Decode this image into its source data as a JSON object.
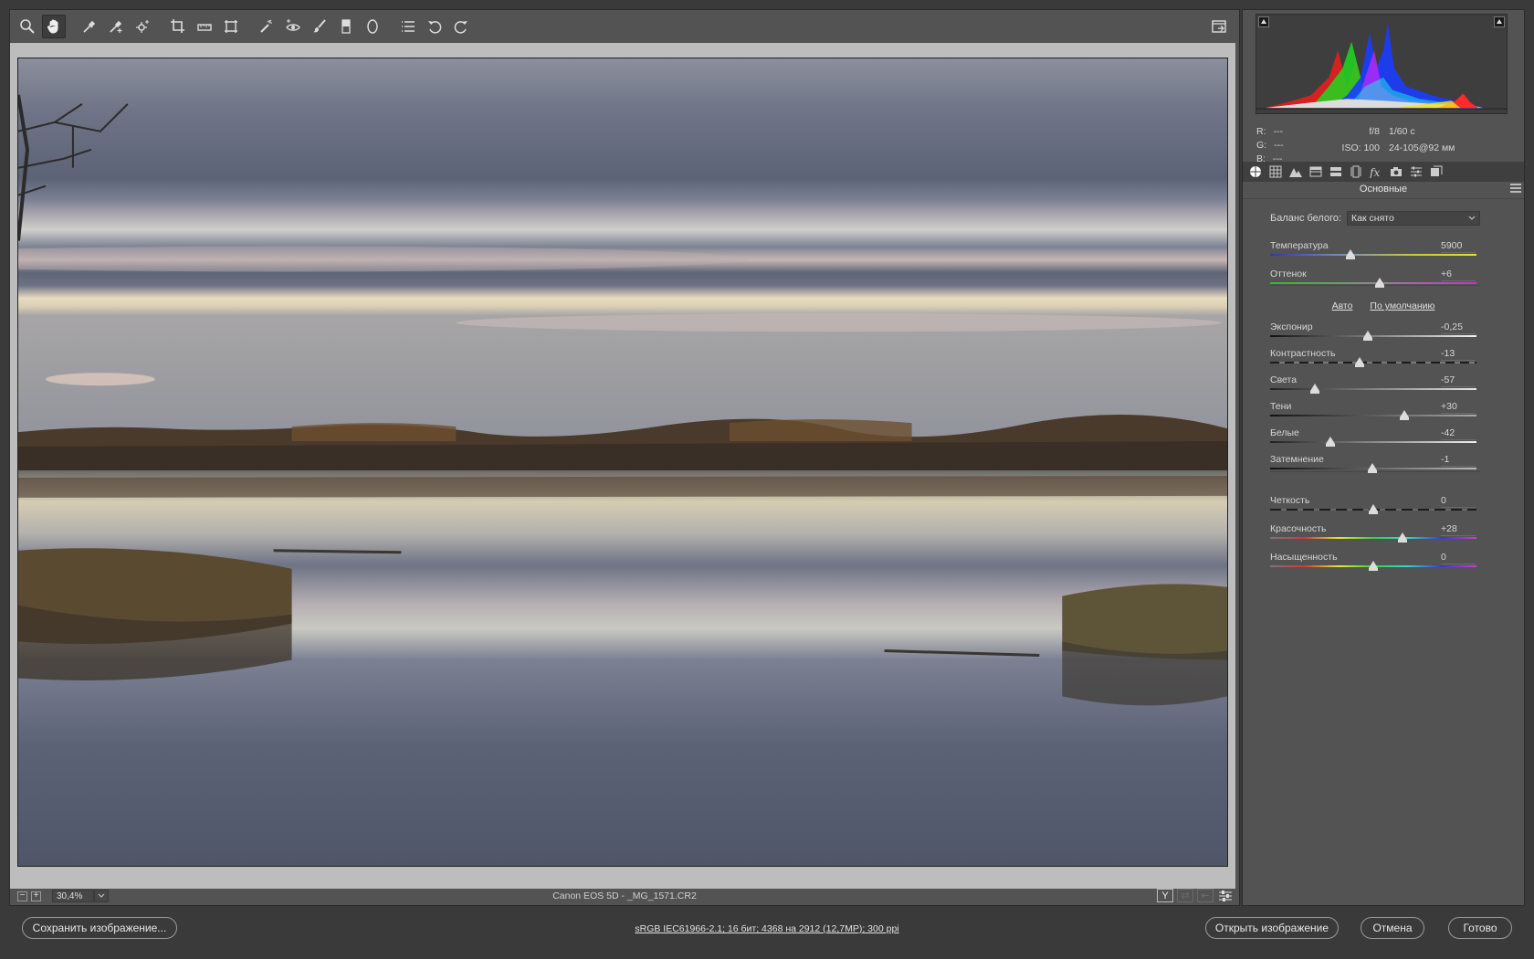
{
  "toolbar": {
    "tools": [
      "zoom-tool",
      "hand-tool",
      "white-balance-tool",
      "color-sampler-tool",
      "targeted-adjustment-tool",
      "crop-tool",
      "straighten-tool",
      "transform-tool",
      "spot-removal-tool",
      "red-eye-tool",
      "adjustment-brush-tool",
      "graduated-filter-tool",
      "radial-filter-tool",
      "presets-list-tool",
      "rotate-ccw-tool",
      "rotate-cw-tool"
    ],
    "active_tool": "hand-tool"
  },
  "status": {
    "zoom": "30,4%",
    "filename": "Canon EOS 5D  -  _MG_1571.CR2"
  },
  "info": {
    "r_label": "R:",
    "r_value": "---",
    "g_label": "G:",
    "g_value": "---",
    "b_label": "B:",
    "b_value": "---",
    "aperture": "f/8",
    "shutter": "1/60 с",
    "iso": "ISO: 100",
    "lens": "24-105@92 мм"
  },
  "panel": {
    "section_title": "Основные",
    "white_balance_label": "Баланс белого:",
    "white_balance_value": "Как снято",
    "auto_link": "Авто",
    "default_link": "По умолчанию",
    "sliders": [
      {
        "id": "temperature",
        "label": "Температура",
        "value": "5900",
        "level": 0.39
      },
      {
        "id": "tint",
        "label": "Оттенок",
        "value": "+6",
        "level": 0.53
      },
      {
        "id": "exposure",
        "label": "Экспонир",
        "value": "-0,25",
        "level": 0.475
      },
      {
        "id": "contrast",
        "label": "Контрастность",
        "value": "-13",
        "level": 0.435
      },
      {
        "id": "highlights",
        "label": "Света",
        "value": "-57",
        "level": 0.215
      },
      {
        "id": "shadows",
        "label": "Тени",
        "value": "+30",
        "level": 0.65
      },
      {
        "id": "whites",
        "label": "Белые",
        "value": "-42",
        "level": 0.29
      },
      {
        "id": "blacks",
        "label": "Затемнение",
        "value": "-1",
        "level": 0.495
      },
      {
        "id": "clarity",
        "label": "Четкость",
        "value": "0",
        "level": 0.5
      },
      {
        "id": "vibrance",
        "label": "Красочность",
        "value": "+28",
        "level": 0.64
      },
      {
        "id": "saturation",
        "label": "Насыщенность",
        "value": "0",
        "level": 0.5
      }
    ]
  },
  "bottom": {
    "save_label": "Сохранить изображение...",
    "workflow": "sRGB IEC61966-2.1; 16 бит; 4368 на 2912 (12,7MP); 300 ppi",
    "open_label": "Открыть изображение",
    "cancel_label": "Отмена",
    "done_label": "Готово"
  },
  "colors": {
    "panel_bg": "#535353",
    "app_bg": "#3a3a3a",
    "canvas_bg": "#bdbdbd"
  }
}
